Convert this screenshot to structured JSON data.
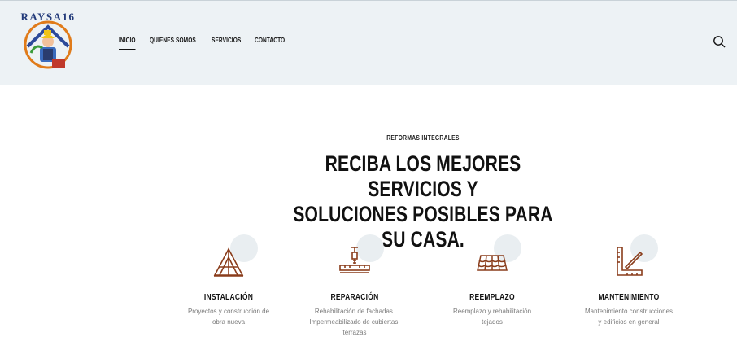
{
  "logo": {
    "text": "RAYSA16",
    "icon": "worker-house-logo"
  },
  "nav": {
    "items": [
      {
        "label": "INICIO",
        "active": true
      },
      {
        "label": "QUIENES SOMOS"
      },
      {
        "label": "SERVICIOS"
      },
      {
        "label": "CONTACTO"
      }
    ],
    "search_icon": "search-icon"
  },
  "hero": {
    "eyebrow": "REFORMAS INTEGRALES",
    "title_line1": "RECIBA LOS MEJORES SERVICIOS Y",
    "title_line2": "SOLUCIONES POSIBLES PARA SU CASA."
  },
  "services": [
    {
      "title": "INSTALACIÓN",
      "icon": "roof-frame-icon",
      "desc_lines": [
        "Proyectos y construcción de",
        "obra nueva"
      ]
    },
    {
      "title": "REPARACIÓN",
      "icon": "drill-level-icon",
      "desc_lines": [
        "Rehabilitación de fachadas.",
        "Impermeabilizado de cubiertas,",
        "terrazas"
      ]
    },
    {
      "title": "REEMPLAZO",
      "icon": "roof-tiles-icon",
      "desc_lines": [
        "Reemplazo y rehabilitación",
        "tejados"
      ]
    },
    {
      "title": "MANTENIMIENTO",
      "icon": "ruler-square-icon",
      "desc_lines": [
        "Mantenimiento construcciones",
        "y edificios en general"
      ]
    }
  ],
  "colors": {
    "header_bg": "#edf2f5",
    "icon_color": "#8a3d1c",
    "bubble": "#e9eef1"
  }
}
